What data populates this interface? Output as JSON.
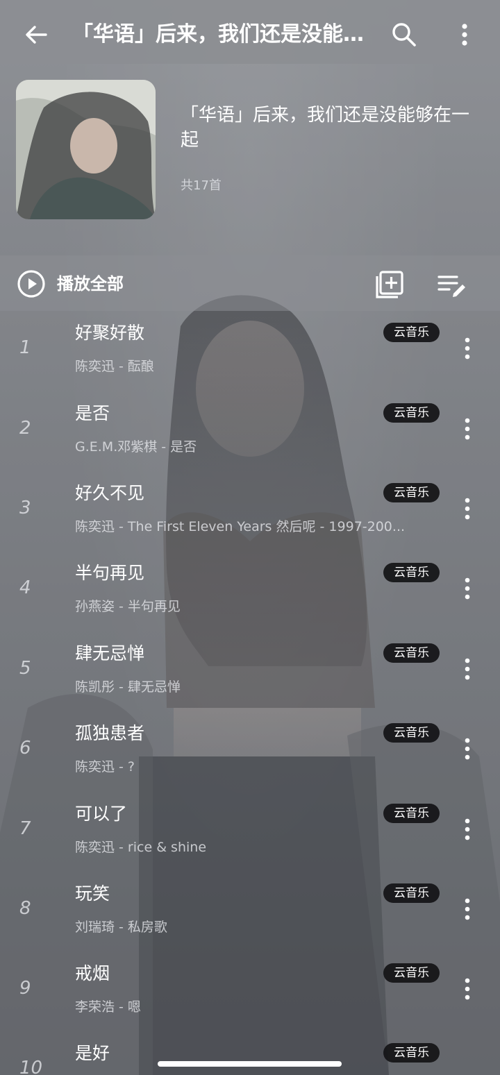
{
  "topbar": {
    "title": "「华语」后来，我们还是没能够在一起",
    "back_icon": "arrow-left-icon",
    "search_icon": "search-icon",
    "more_icon": "more-vertical-icon"
  },
  "playlist": {
    "name": "「华语」后来，我们还是没能够在一起",
    "count": "共17首"
  },
  "controls": {
    "play_all_label": "播放全部",
    "add_icon": "add-to-playlist-icon",
    "edit_icon": "edit-list-icon"
  },
  "songs": [
    {
      "index": "1",
      "title": "好聚好散",
      "subtitle": "陈奕迅 - 酝酿",
      "source": "云音乐"
    },
    {
      "index": "2",
      "title": "是否",
      "subtitle": "G.E.M.邓紫棋 - 是否",
      "source": "云音乐"
    },
    {
      "index": "3",
      "title": "好久不见",
      "subtitle": "陈奕迅 - The First Eleven Years 然后呢 - 1997-200...",
      "source": "云音乐"
    },
    {
      "index": "4",
      "title": "半句再见",
      "subtitle": "孙燕姿 - 半句再见",
      "source": "云音乐"
    },
    {
      "index": "5",
      "title": "肆无忌惮",
      "subtitle": "陈凯彤 - 肆无忌惮",
      "source": "云音乐"
    },
    {
      "index": "6",
      "title": "孤独患者",
      "subtitle": "陈奕迅 - ?",
      "source": "云音乐"
    },
    {
      "index": "7",
      "title": "可以了",
      "subtitle": "陈奕迅 - rice & shine",
      "source": "云音乐"
    },
    {
      "index": "8",
      "title": "玩笑",
      "subtitle": "刘瑞琦 - 私房歌",
      "source": "云音乐"
    },
    {
      "index": "9",
      "title": "戒烟",
      "subtitle": "李荣浩 - 嗯",
      "source": "云音乐"
    },
    {
      "index": "10",
      "title": "是好",
      "subtitle": "",
      "source": "云音乐"
    }
  ],
  "colors": {
    "badge_bg": "#141416",
    "text": "#ffffff",
    "bar": "#8c8e93"
  }
}
